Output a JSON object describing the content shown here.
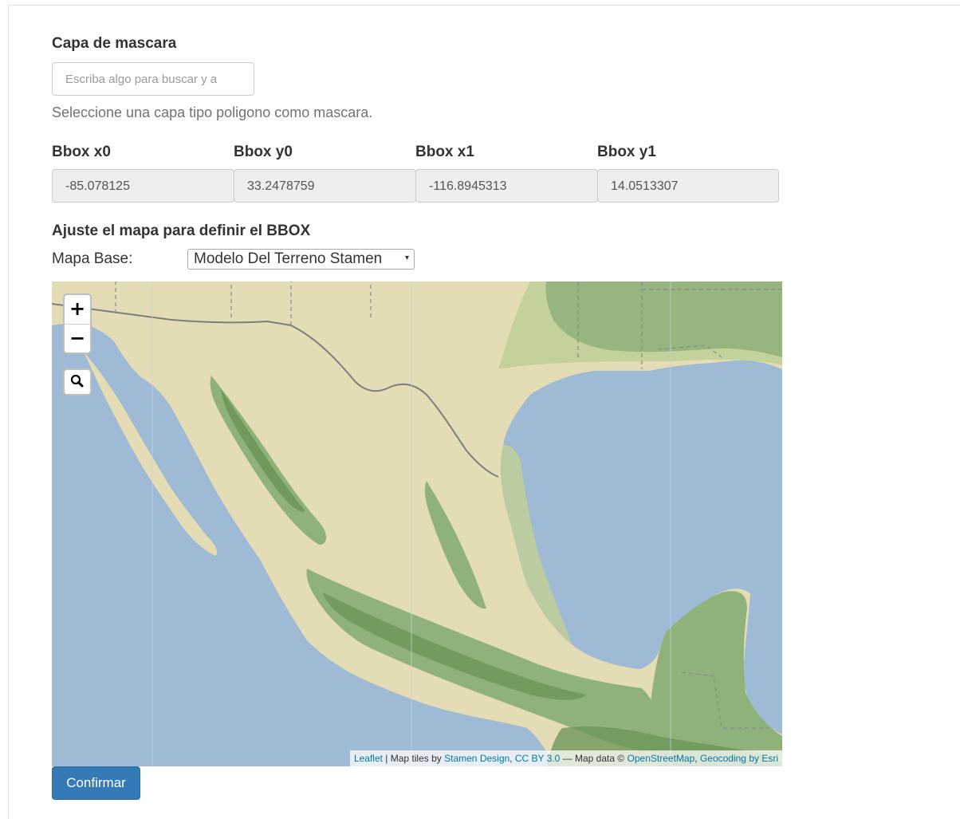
{
  "form": {
    "mask_heading": "Capa de mascara",
    "search_placeholder": "Escriba algo para buscar y a",
    "mask_help": "Seleccione una capa tipo poligono como mascara."
  },
  "bbox": {
    "fields": [
      {
        "label": "Bbox x0",
        "value": "-85.078125"
      },
      {
        "label": "Bbox y0",
        "value": "33.2478759"
      },
      {
        "label": "Bbox x1",
        "value": "-116.8945313"
      },
      {
        "label": "Bbox y1",
        "value": "14.0513307"
      }
    ]
  },
  "map_section": {
    "heading": "Ajuste el mapa para definir el BBOX",
    "base_map_label": "Mapa Base:",
    "base_map_selected": "Modelo Del Terreno Stamen",
    "select_arrow": "▾"
  },
  "map": {
    "zoom_in_label": "+",
    "zoom_out_label": "−",
    "colors": {
      "water": "#9fbad4",
      "land": "#e4dcb4",
      "lowland_green": "#bfcf98",
      "forest": "#8fb27a",
      "mountains": "#6e9659",
      "border": "#7e7e7e"
    },
    "attribution": {
      "leaflet": "Leaflet",
      "sep1": " | Map tiles by ",
      "stamen": "Stamen Design",
      "comma1": ", ",
      "license": "CC BY 3.0",
      "sep2": " — Map data © ",
      "osm": "OpenStreetMap",
      "comma2": ", ",
      "esri": "Geocoding by Esri"
    }
  },
  "actions": {
    "confirm_label": "Confirmar"
  }
}
